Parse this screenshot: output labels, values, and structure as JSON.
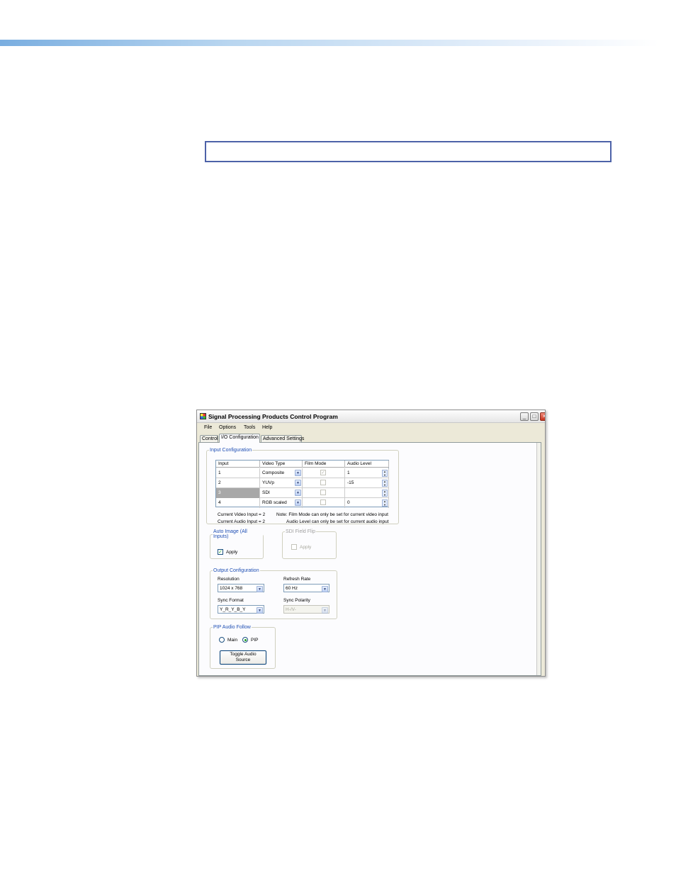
{
  "window": {
    "title": "Signal Processing Products Control Program",
    "controls": {
      "minimize": "_",
      "maximize": "□",
      "close": "×"
    }
  },
  "menu": [
    "File",
    "Options",
    "Tools",
    "Help"
  ],
  "tabs": [
    {
      "label": "Control",
      "active": false
    },
    {
      "label": "I/O Configuration",
      "active": true
    },
    {
      "label": "Advanced Settings",
      "active": false
    }
  ],
  "input_config": {
    "legend": "Input Configuration",
    "columns": [
      "Input",
      "Video Type",
      "Film Mode",
      "Audio Level"
    ],
    "rows": [
      {
        "input": "1",
        "video_type": "Composite",
        "film_checked": "✓",
        "audio": "1"
      },
      {
        "input": "2",
        "video_type": "YUVp",
        "film_checked": "",
        "audio": "-15"
      },
      {
        "input": "3",
        "video_type": "SDI",
        "film_checked": "",
        "audio": ""
      },
      {
        "input": "4",
        "video_type": "RGB scaled",
        "film_checked": "",
        "audio": "0"
      }
    ],
    "current_video": "Current Video Input = 2",
    "current_audio": "Current Audio Input = 2",
    "note1": "Note:  Film Mode can only be set for current video input",
    "note2": "Audio Level can only be set for current audio input"
  },
  "auto_image": {
    "legend": "Auto Image (All Inputs)",
    "apply_label": "Apply",
    "checked": "✓"
  },
  "sdi_field_flip": {
    "legend": "SDI Field Flip",
    "apply_label": "Apply"
  },
  "output_config": {
    "legend": "Output Configuration",
    "resolution_label": "Resolution",
    "resolution_value": "1024 x 768",
    "refresh_label": "Refresh Rate",
    "refresh_value": "60 Hz",
    "sync_format_label": "Sync Format",
    "sync_format_value": "Y_R_Y_B_Y",
    "sync_polarity_label": "Sync Polarity",
    "sync_polarity_value": "H-/V-"
  },
  "pip_audio": {
    "legend": "PIP Audio Follow",
    "main_label": "Main",
    "pip_label": "PIP",
    "toggle_line1": "Toggle Audio",
    "toggle_line2": "Source"
  }
}
